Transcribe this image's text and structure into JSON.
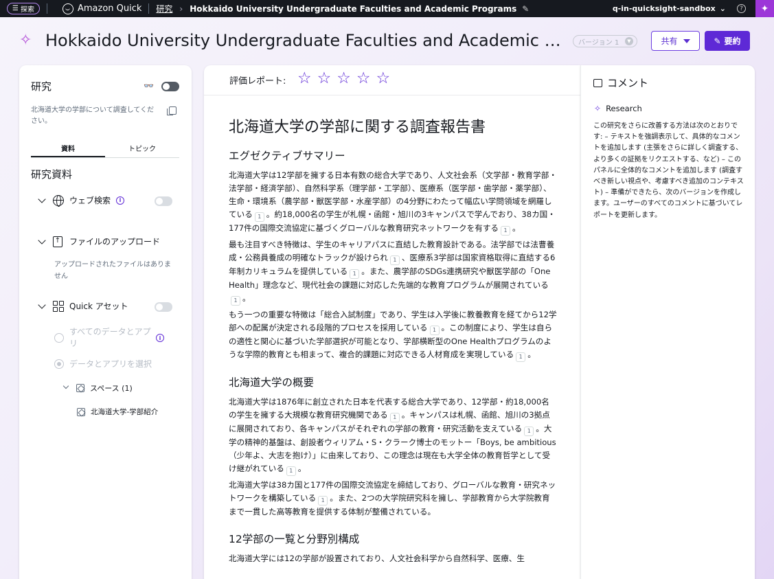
{
  "topbar": {
    "explore_label": "探索",
    "brand": "Amazon Quick",
    "breadcrumb_link": "研究",
    "breadcrumb_current": "Hokkaido University Undergraduate Faculties and Academic Programs",
    "account": "q-in-quicksight-sandbox"
  },
  "header": {
    "title": "Hokkaido University Undergraduate Faculties and Academic Prog…",
    "version": "バージョン 1",
    "share_label": "共有",
    "summary_label": "要約"
  },
  "research_panel": {
    "title": "研究",
    "description": "北海道大学の学部について調査してください。",
    "tabs": [
      "資料",
      "トピック"
    ],
    "section_title": "研究資料",
    "web_search": "ウェブ検索",
    "file_upload": "ファイルのアップロード",
    "no_files": "アップロードされたファイルはありません",
    "quick_assets": "Quick アセット",
    "all_data_apps": "すべてのデータとアプリ",
    "select_data_apps": "データとアプリを選択",
    "spaces": "スペース (1)",
    "space_item": "北海道大学-学部紹介"
  },
  "document": {
    "rating_label": "評価レポート:",
    "h1": "北海道大学の学部に関する調査報告書",
    "sections": [
      {
        "heading": "エグゼクティブサマリー",
        "paragraphs": [
          [
            "北海道大学は12学部を擁する日本有数の総合大学であり、人文社会系（文学部・教育学部・法学部・経済学部）、自然科学系（理学部・工学部）、医療系（医学部・歯学部・薬学部）、生命・環境系（農学部・獣医学部・水産学部）の4分野にわたって幅広い学問領域を網羅している",
            "1",
            "。約18,000名の学生が札幌・函館・旭川の3キャンパスで学んでおり、38カ国・177件の国際交流協定に基づくグローバルな教育研究ネットワークを有する",
            "1",
            "。"
          ],
          [
            "最も注目すべき特徴は、学生のキャリアパスに直結した教育設計である。法学部では法曹養成・公務員養成の明確なトラックが設けられ",
            "1",
            "、医療系3学部は国家資格取得に直結する6年制カリキュラムを提供している",
            "1",
            "。また、農学部のSDGs連携研究や獣医学部の「One Health」理念など、現代社会の課題に対応した先端的な教育プログラムが展開されている",
            "1",
            "。"
          ],
          [
            "もう一つの重要な特徴は「総合入試制度」であり、学生は入学後に教養教育を経てから12学部への配属が決定される段階的プロセスを採用している",
            "1",
            "。この制度により、学生は自らの適性と関心に基づいた学部選択が可能となり、学部横断型のOne Healthプログラムのような学際的教育とも相まって、複合的課題に対応できる人材育成を実現している",
            "1",
            "。"
          ]
        ]
      },
      {
        "heading": "北海道大学の概要",
        "paragraphs": [
          [
            "北海道大学は1876年に創立された日本を代表する総合大学であり、12学部・約18,000名の学生を擁する大規模な教育研究機関である",
            "1",
            "。キャンパスは札幌、函館、旭川の3拠点に展開されており、各キャンパスがそれぞれの学部の教育・研究活動を支えている",
            "1",
            "。大学の精神的基盤は、創設者ウィリアム・S・クラーク博士のモットー「Boys, be ambitious（少年よ、大志を抱け）」に由来しており、この理念は現在も大学全体の教育哲学として受け継がれている",
            "1",
            "。"
          ],
          [
            "北海道大学は38カ国と177件の国際交流協定を締結しており、グローバルな教育・研究ネットワークを構築している",
            "1",
            "。また、2つの大学院研究科を擁し、学部教育から大学院教育まで一貫した高等教育を提供する体制が整備されている。"
          ]
        ]
      },
      {
        "heading": "12学部の一覧と分野別構成",
        "paragraphs": [
          [
            "北海道大学には12の学部が設置されており、人文社会科学から自然科学、医療、生"
          ]
        ]
      }
    ]
  },
  "comments": {
    "title": "コメント",
    "author": "Research",
    "text": "この研究をさらに改善する方法は次のとおりです: – テキストを強調表示して、具体的なコメントを追加します (主張をさらに詳しく調査する、より多くの証拠をリクエストする、など) – このパネルに全体的なコメントを追加します (調査すべき新しい視点や、考慮すべき追加のコンテキスト) – 準備ができたら、次のバージョンを作成します。ユーザーのすべてのコメントに基づいてレポートを更新します。"
  }
}
